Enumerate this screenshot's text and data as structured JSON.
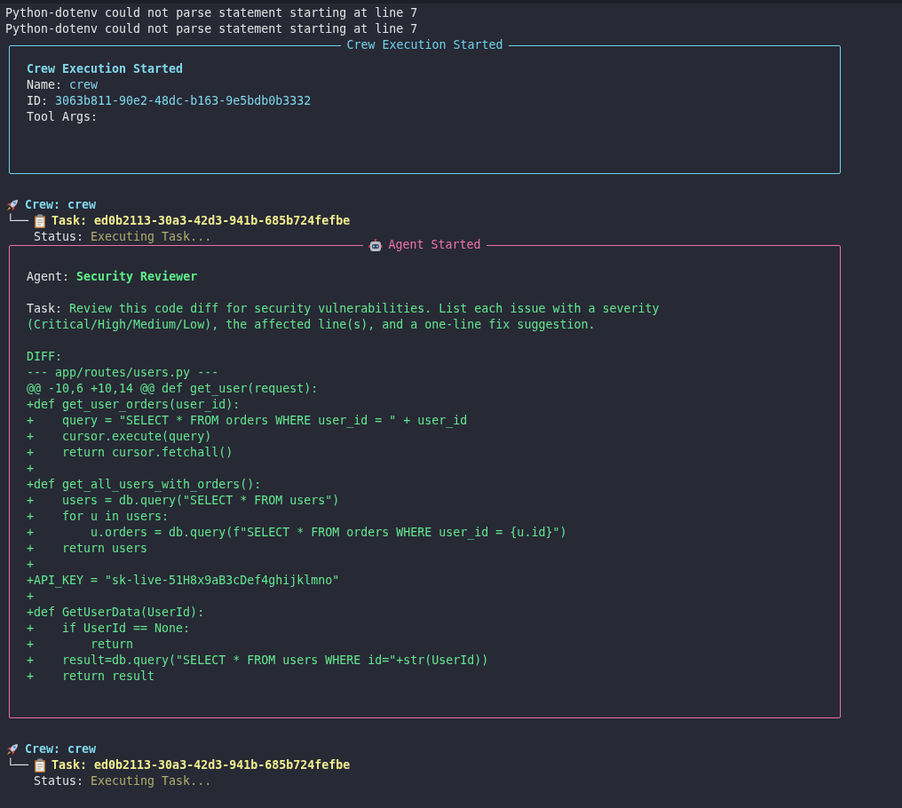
{
  "log_lines": [
    "Python-dotenv could not parse statement starting at line 7",
    "Python-dotenv could not parse statement starting at line 7"
  ],
  "crew_panel": {
    "title": "Crew Execution Started",
    "heading": "Crew Execution Started",
    "fields": [
      {
        "label": "Name:",
        "value": "crew"
      },
      {
        "label": "ID:",
        "value": "3063b811-90e2-48dc-b163-9e5bdb0b3332"
      },
      {
        "label": "Tool Args:"
      }
    ]
  },
  "trees": [
    {
      "crew": "Crew: crew",
      "branch": "└──",
      "task": "Task: ed0b2113-30a3-42d3-941b-685b724fefbe",
      "status_label": "Status:",
      "status": "Executing Task..."
    }
  ],
  "agent_panel": {
    "title": "Agent Started",
    "agent_label": "Agent:",
    "agent": "Security Reviewer",
    "task_label": "Task:",
    "task": "Review this code diff for security vulnerabilities. List each issue with a severity (Critical/High/Medium/Low), the affected line(s), and a one-line fix suggestion.",
    "diff_lines": [
      "DIFF:",
      "--- app/routes/users.py ---",
      "@@ -10,6 +10,14 @@ def get_user(request):",
      "+def get_user_orders(user_id):",
      "+    query = \"SELECT * FROM orders WHERE user_id = \" + user_id",
      "+    cursor.execute(query)",
      "+    return cursor.fetchall()",
      "+",
      "+def get_all_users_with_orders():",
      "+    users = db.query(\"SELECT * FROM users\")",
      "+    for u in users:",
      "+        u.orders = db.query(f\"SELECT * FROM orders WHERE user_id = {u.id}\")",
      "+    return users",
      "+",
      "+API_KEY = \"sk-live-51H8x9aB3cDef4ghijklmno\"",
      "+",
      "+def GetUserData(UserId):",
      "+    if UserId == None:",
      "+        return",
      "+    result=db.query(\"SELECT * FROM users WHERE id=\"+str(UserId))",
      "+    return result"
    ]
  },
  "trees_after": [
    {
      "crew": "Crew: crew",
      "branch": "└──",
      "task": "Task: ed0b2113-30a3-42d3-941b-685b724fefbe",
      "status_label": "Status:",
      "status": "Executing Task..."
    }
  ]
}
